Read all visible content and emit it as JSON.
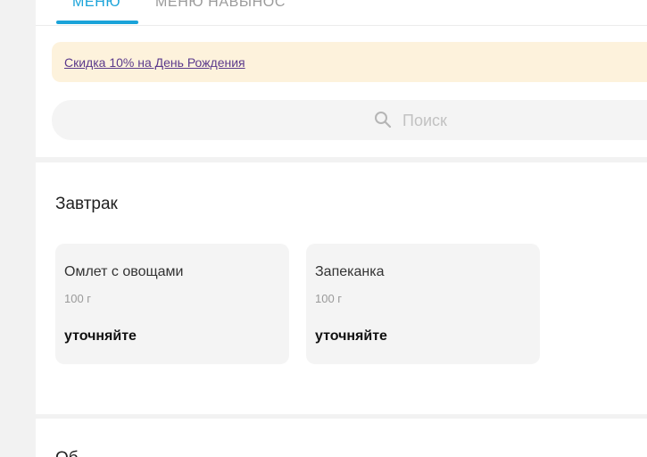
{
  "tabs": [
    {
      "label": "МЕНЮ",
      "active": true
    },
    {
      "label": "МЕНЮ НАВЫНОС",
      "active": false
    }
  ],
  "promo": {
    "text": "Скидка 10% на День Рождения"
  },
  "search": {
    "placeholder": "Поиск",
    "icon": "search-icon"
  },
  "sections": [
    {
      "title": "Завтрак",
      "items": [
        {
          "name": "Омлет с овощами",
          "weight": "100 г",
          "price": "уточняйте"
        },
        {
          "name": "Запеканка",
          "weight": "100 г",
          "price": "уточняйте"
        }
      ]
    },
    {
      "title": "Об"
    }
  ],
  "colors": {
    "accent": "#1aa3d9",
    "promo_bg": "#fdf2dc",
    "promo_link": "#5b3a8c",
    "card_bg": "#f4f4f4",
    "page_bg": "#f2f2f2"
  }
}
